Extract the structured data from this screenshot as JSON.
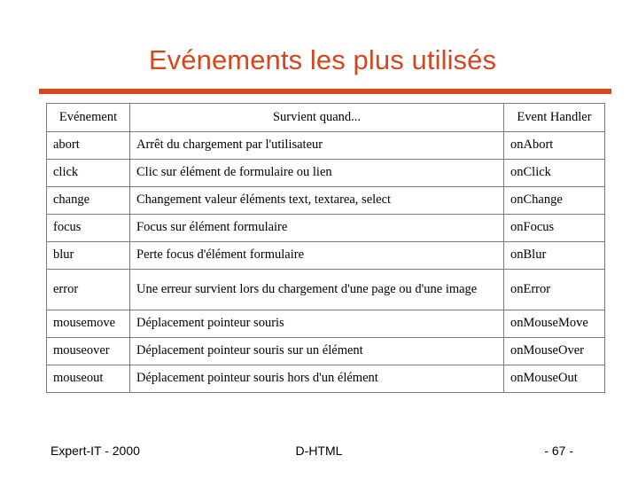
{
  "slide": {
    "title": "Evénements les plus utilisés",
    "accent_color": "#d8481f",
    "title_color": "#d4471e"
  },
  "table": {
    "headers": {
      "event": "Evénement",
      "description": "Survient quand...",
      "handler": "Event Handler"
    },
    "rows": [
      {
        "event": "abort",
        "description": "Arrêt du chargement par l'utilisateur",
        "handler": "onAbort"
      },
      {
        "event": "click",
        "description": "Clic sur élément de formulaire ou lien",
        "handler": "onClick"
      },
      {
        "event": "change",
        "description": "Changement valeur éléments text, textarea, select",
        "handler": "onChange"
      },
      {
        "event": "focus",
        "description": "Focus sur élément formulaire",
        "handler": "onFocus"
      },
      {
        "event": "blur",
        "description": "Perte focus d'élément formulaire",
        "handler": "onBlur"
      },
      {
        "event": "error",
        "description": "Une erreur survient lors du chargement d'une page ou d'une image",
        "handler": "onError"
      },
      {
        "event": "mousemove",
        "description": "Déplacement pointeur souris",
        "handler": "onMouseMove"
      },
      {
        "event": "mouseover",
        "description": "Déplacement pointeur souris sur un élément",
        "handler": "onMouseOver"
      },
      {
        "event": "mouseout",
        "description": "Déplacement pointeur souris hors d'un élément",
        "handler": "onMouseOut"
      }
    ]
  },
  "footer": {
    "left": "Expert-IT - 2000",
    "center": "D-HTML",
    "right": "- 67 -"
  }
}
